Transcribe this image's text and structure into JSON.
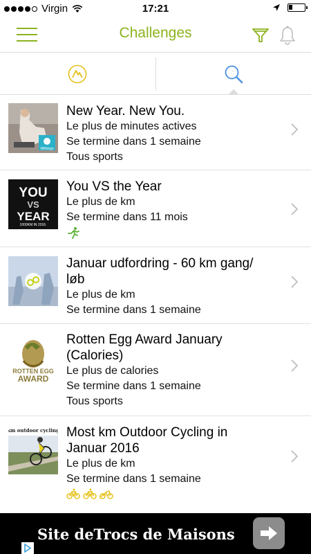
{
  "status_bar": {
    "carrier": "Virgin",
    "time": "17:21",
    "icons": [
      "signal-dots-icon",
      "wifi-icon",
      "location-arrow-icon",
      "battery-icon"
    ]
  },
  "nav": {
    "title": "Challenges",
    "icons": [
      "menu-icon",
      "filter-icon",
      "bell-icon"
    ]
  },
  "tabs": [
    {
      "icon": "mountain-challenge-icon",
      "active": false
    },
    {
      "icon": "search-icon",
      "active": true
    }
  ],
  "challenges": [
    {
      "title": "New Year. New You.",
      "metric": "Le plus de minutes actives",
      "ends": "Se termine dans 1 semaine",
      "sports": "Tous sports",
      "thumb_label": "Withings"
    },
    {
      "title": "You VS the Year",
      "metric": "Le plus de km",
      "ends": "Se termine dans 11 mois",
      "sport_icons": [
        "running-icon"
      ],
      "thumb_words": [
        "YOU",
        "VS",
        "YEAR"
      ],
      "thumb_caption": "1000KM IN 2016."
    },
    {
      "title_line1": "Januar udfordring - 60 km gang/",
      "title_line2": "løb",
      "metric": "Le plus de km",
      "ends": "Se termine dans 1 semaine"
    },
    {
      "title_line1": "Rotten Egg Award January",
      "title_line2": "(Calories)",
      "metric": "Le plus de calories",
      "ends": "Se termine dans 1 semaine",
      "sports": "Tous sports",
      "thumb_words": [
        "ROTTEN EGG",
        "AWARD"
      ]
    },
    {
      "title_line1": "Most km Outdoor Cycling in",
      "title_line2": "Januar 2016",
      "metric": "Le plus de km",
      "ends": "Se termine dans 1 semaine",
      "sport_icons": [
        "cycling-icon",
        "cycling-icon",
        "mountain-bike-icon"
      ],
      "thumb_caption": "km outdoor cycling"
    }
  ],
  "ad": {
    "text": "Site deTrocs de Maisons",
    "button_icon": "arrow-right-icon",
    "info_icon": "adchoices-icon"
  },
  "colors": {
    "accent": "#8cb31e",
    "sport_icon": "#e6c11a",
    "divider": "#dcdcdc",
    "ad_bg": "#000000"
  }
}
